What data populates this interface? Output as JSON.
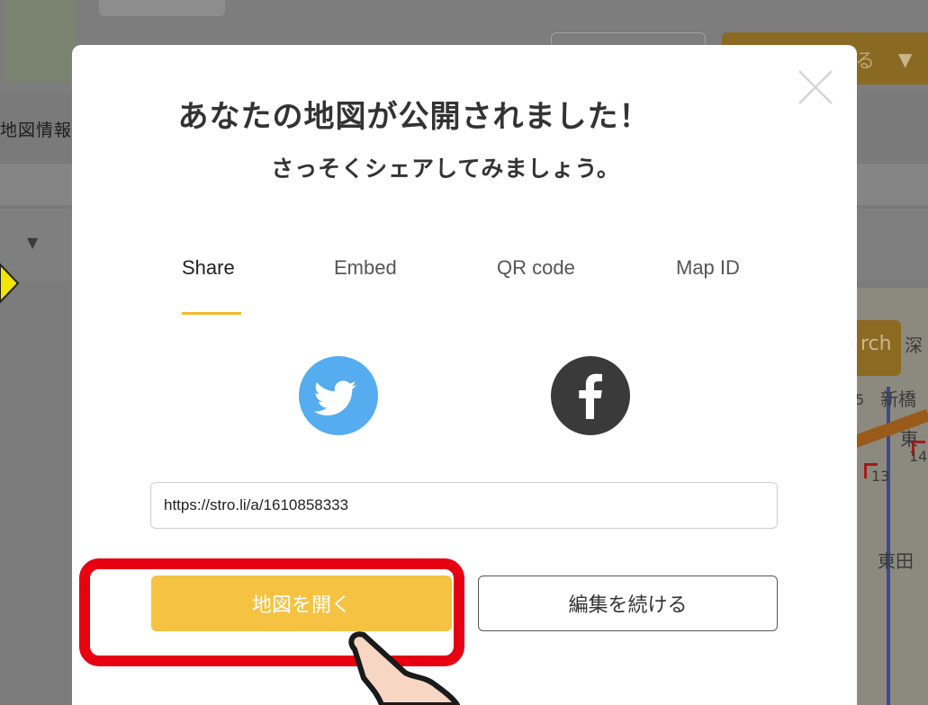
{
  "background": {
    "tab_label": "地図情報",
    "search_partial": "rch",
    "station_top": "新橋",
    "station_partial_1": "深",
    "station_partial_2": "東",
    "flag_label_1": "14",
    "flag_label_2": "13",
    "station_bottom": "東田",
    "partial_number": "5"
  },
  "modal": {
    "title": "あなたの地図が公開されました！",
    "subtitle": "さっそくシェアしてみましょう。",
    "close_icon": "close-icon",
    "tabs": [
      {
        "label": "Share",
        "active": true
      },
      {
        "label": "Embed",
        "active": false
      },
      {
        "label": "QR code",
        "active": false
      },
      {
        "label": "Map ID",
        "active": false
      }
    ],
    "social": [
      {
        "icon": "twitter-icon",
        "color": "#55acee"
      },
      {
        "icon": "facebook-icon",
        "color": "#3a3a3a"
      }
    ],
    "share_url": "https://stro.li/a/1610858333",
    "open_map_label": "地図を開く",
    "continue_edit_label": "編集を続ける"
  },
  "colors": {
    "accent": "#f5c242",
    "tab_underline": "#f5b82e",
    "highlight": "#e60012"
  }
}
